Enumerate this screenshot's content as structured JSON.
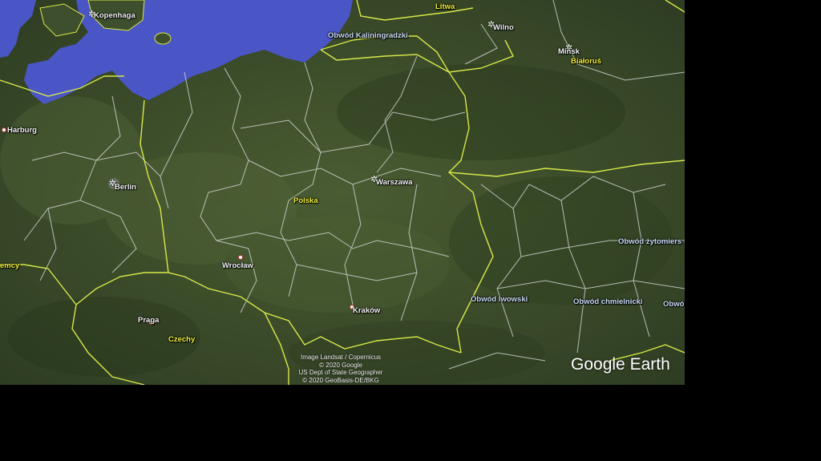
{
  "map": {
    "places": [
      {
        "id": "kopenhaga",
        "text": "Kopenhaga",
        "style": "white",
        "marker": "star"
      },
      {
        "id": "litwa",
        "text": "Litwa",
        "style": "yellow",
        "marker": "none"
      },
      {
        "id": "wilno",
        "text": "Wilno",
        "style": "white",
        "marker": "star"
      },
      {
        "id": "obwod-kaliningradzki",
        "text": "Obwód Kaliningradzki",
        "style": "blue",
        "marker": "none"
      },
      {
        "id": "minsk",
        "text": "Mińsk",
        "style": "white",
        "marker": "star"
      },
      {
        "id": "bialorus",
        "text": "Białoruś",
        "style": "yellow",
        "marker": "none"
      },
      {
        "id": "harburg",
        "text": "Harburg",
        "style": "white",
        "marker": "dot"
      },
      {
        "id": "berlin",
        "text": "Berlin",
        "style": "white",
        "marker": "star"
      },
      {
        "id": "warszawa",
        "text": "Warszawa",
        "style": "white",
        "marker": "star"
      },
      {
        "id": "polska",
        "text": "Polska",
        "style": "yellow",
        "marker": "none"
      },
      {
        "id": "niemcy",
        "text": "emcy",
        "style": "yellow",
        "marker": "none"
      },
      {
        "id": "wroclaw",
        "text": "Wrocław",
        "style": "white",
        "marker": "dot"
      },
      {
        "id": "obwod-zytomierski",
        "text": "Obwód żytomiers",
        "style": "blue",
        "marker": "none"
      },
      {
        "id": "obwod-lwowski",
        "text": "Obwód lwowski",
        "style": "blue",
        "marker": "none"
      },
      {
        "id": "obwod-chmielnicki",
        "text": "Obwód chmielnicki",
        "style": "blue",
        "marker": "none"
      },
      {
        "id": "obwod-cut",
        "text": "Obwó",
        "style": "blue",
        "marker": "none"
      },
      {
        "id": "krakow",
        "text": "Kraków",
        "style": "white",
        "marker": "dot"
      },
      {
        "id": "praga",
        "text": "Praga",
        "style": "white",
        "marker": "dot"
      },
      {
        "id": "czechy",
        "text": "Czechy",
        "style": "yellow",
        "marker": "none"
      }
    ],
    "colors": {
      "sea": "#4a57c9",
      "land": "#3d4f2c",
      "country_border": "#d8e84a",
      "region_border": "#d8d8d8"
    }
  },
  "attribution": {
    "line1": "Image Landsat / Copernicus",
    "line2": "© 2020 Google",
    "line3": "US Dept of State Geographer",
    "line4": "© 2020 GeoBasis-DE/BKG"
  },
  "logo": {
    "google": "Google",
    "earth": "Earth"
  }
}
